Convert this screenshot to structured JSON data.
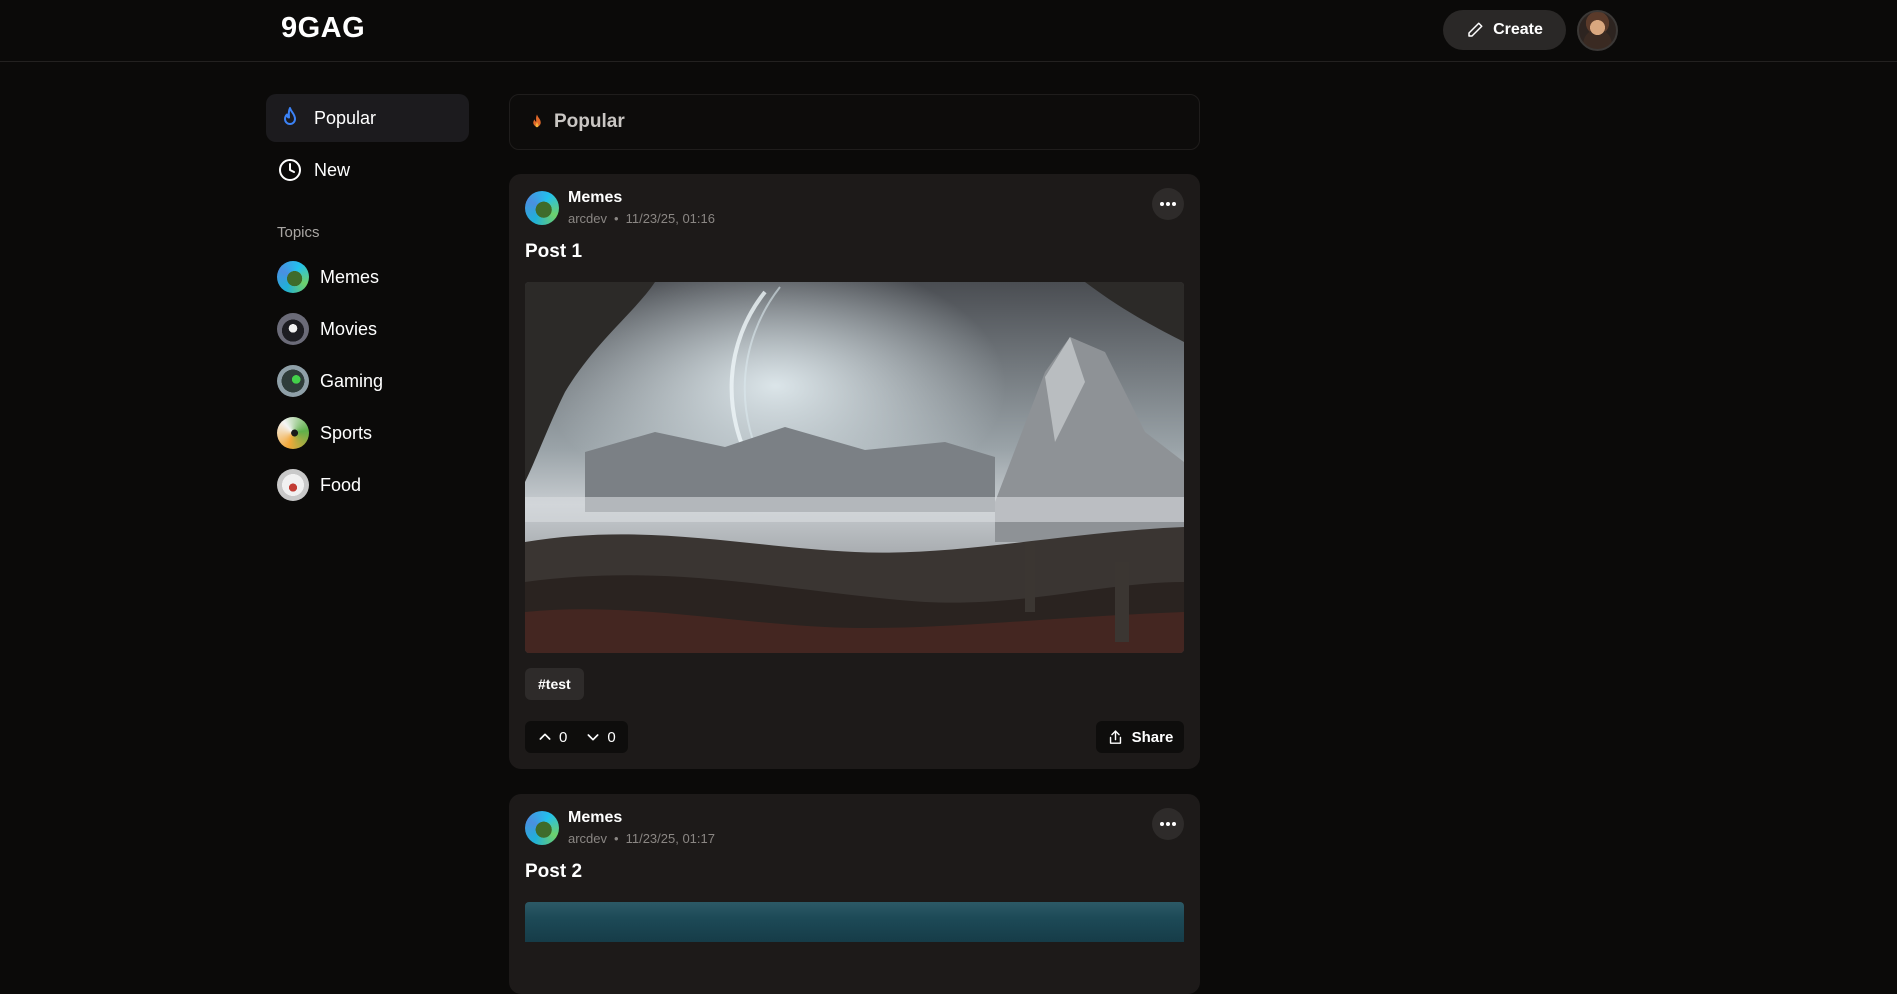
{
  "app": {
    "logo": "9GAG"
  },
  "header": {
    "create_label": "Create"
  },
  "sidebar": {
    "nav": [
      {
        "label": "Popular",
        "icon": "flame-icon",
        "active": true
      },
      {
        "label": "New",
        "icon": "clock-icon",
        "active": false
      }
    ],
    "topics_label": "Topics",
    "topics": [
      {
        "label": "Memes"
      },
      {
        "label": "Movies"
      },
      {
        "label": "Gaming"
      },
      {
        "label": "Sports"
      },
      {
        "label": "Food"
      }
    ]
  },
  "feed": {
    "heading": "Popular",
    "posts": [
      {
        "topic": "Memes",
        "author": "arcdev",
        "separator": "•",
        "time": "11/23/25, 01:16",
        "title": "Post 1",
        "tag": "#test",
        "upvotes": "0",
        "downvotes": "0",
        "share_label": "Share"
      },
      {
        "topic": "Memes",
        "author": "arcdev",
        "separator": "•",
        "time": "11/23/25, 01:17",
        "title": "Post 2"
      }
    ]
  },
  "colors": {
    "background": "#0b0a09",
    "card": "#1d1a19",
    "accent_blue": "#3b82f6",
    "flame_orange": "#e0692a"
  }
}
